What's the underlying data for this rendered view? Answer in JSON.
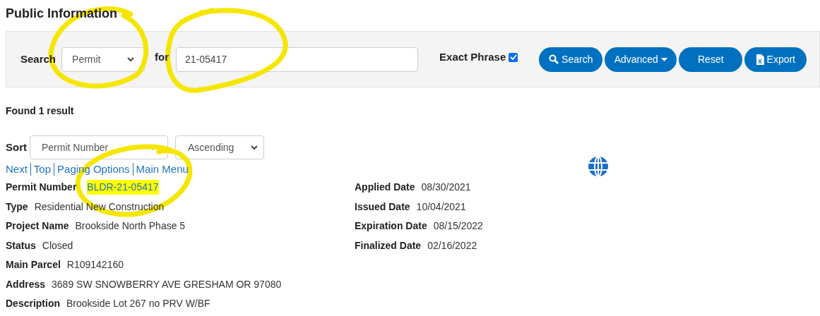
{
  "page_title": "Public Information",
  "search": {
    "label": "Search",
    "type_select": "Permit",
    "for_label": "for",
    "query": "21-05417",
    "exact_phrase_label": "Exact Phrase",
    "exact_phrase_checked": true,
    "buttons": [
      {
        "kind": "search",
        "label": "Search"
      },
      {
        "kind": "dropdown",
        "label": "Advanced"
      },
      {
        "kind": "plain",
        "label": "Reset"
      },
      {
        "kind": "export",
        "label": "Export"
      }
    ]
  },
  "result_count": "Found 1 result",
  "sort": {
    "label": "Sort",
    "field": "Permit Number",
    "order": "Ascending"
  },
  "links": [
    "Next",
    "Top",
    "Paging Options",
    "Main Menu"
  ],
  "details_left": [
    {
      "label": "Permit Number",
      "value": "BLDR-21-05417",
      "kind": "link",
      "highlighted": true
    },
    {
      "label": "Type",
      "value": "Residential New Construction",
      "kind": "text",
      "highlighted": false
    },
    {
      "label": "Project Name",
      "value": "Brookside North Phase 5",
      "kind": "text",
      "highlighted": false
    },
    {
      "label": "Status",
      "value": "Closed",
      "kind": "text",
      "highlighted": false
    },
    {
      "label": "Main Parcel",
      "value": "R109142160",
      "kind": "text",
      "highlighted": false
    },
    {
      "label": "Address",
      "value": "3689 SW SNOWBERRY AVE GRESHAM OR 97080",
      "kind": "text",
      "highlighted": false
    },
    {
      "label": "Description",
      "value": "Brookside Lot 267 no PRV W/BF",
      "kind": "text",
      "highlighted": false
    }
  ],
  "details_right": [
    {
      "label": "Applied Date",
      "value": "08/30/2021"
    },
    {
      "label": "Issued Date",
      "value": "10/04/2021"
    },
    {
      "label": "Expiration Date",
      "value": "08/15/2022"
    },
    {
      "label": "Finalized Date",
      "value": "02/16/2022"
    }
  ]
}
